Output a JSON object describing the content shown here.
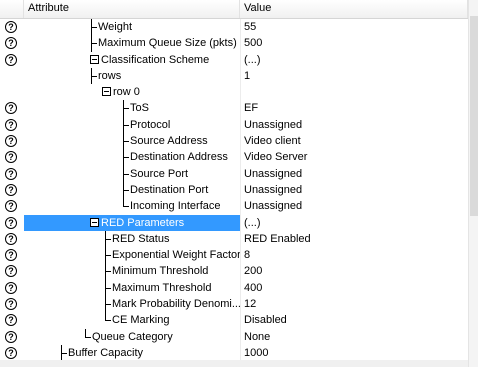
{
  "header": {
    "attribute": "Attribute",
    "value": "Value"
  },
  "help_glyph": "?",
  "rows": [
    {
      "label": "Weight",
      "value": "55"
    },
    {
      "label": "Maximum Queue Size (pkts)",
      "value": "500"
    },
    {
      "label": "Classification Scheme",
      "value": "(...)"
    },
    {
      "label": "rows",
      "value": "1"
    },
    {
      "label": "row 0",
      "value": ""
    },
    {
      "label": "ToS",
      "value": "EF"
    },
    {
      "label": "Protocol",
      "value": "Unassigned"
    },
    {
      "label": "Source Address",
      "value": "Video client"
    },
    {
      "label": "Destination Address",
      "value": "Video Server"
    },
    {
      "label": "Source Port",
      "value": "Unassigned"
    },
    {
      "label": "Destination Port",
      "value": "Unassigned"
    },
    {
      "label": "Incoming Interface",
      "value": "Unassigned"
    },
    {
      "label": "RED Parameters",
      "value": "(...)"
    },
    {
      "label": "RED Status",
      "value": "RED Enabled"
    },
    {
      "label": "Exponential Weight Factor",
      "value": "8"
    },
    {
      "label": "Minimum Threshold",
      "value": "200"
    },
    {
      "label": "Maximum Threshold",
      "value": "400"
    },
    {
      "label": "Mark Probability Denomi...",
      "value": "12"
    },
    {
      "label": "CE Marking",
      "value": "Disabled"
    },
    {
      "label": "Queue Category",
      "value": "None"
    },
    {
      "label": "Buffer Capacity",
      "value": "1000"
    }
  ],
  "colors": {
    "selection": "#3399ff"
  }
}
